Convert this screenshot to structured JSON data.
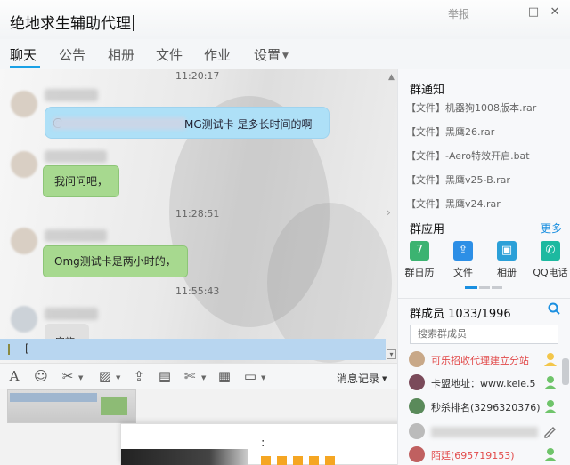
{
  "window": {
    "title": "绝地求生辅助代理",
    "report": "举报",
    "min_icon": "minimize-icon",
    "max_icon": "maximize-icon",
    "close_icon": "close-icon"
  },
  "tabs": [
    {
      "label": "聊天",
      "active": true
    },
    {
      "label": "公告"
    },
    {
      "label": "相册"
    },
    {
      "label": "文件"
    },
    {
      "label": "作业",
      "badge_dot": true
    },
    {
      "label": "设置"
    }
  ],
  "chat": {
    "messages": [
      {
        "time": "11:20:17"
      },
      {
        "text": "@",
        "tail": "MG测试卡 是多长时间的啊",
        "style": "blue"
      },
      {
        "text": "我问问吧，",
        "style": "green"
      },
      {
        "time": "11:28:51"
      },
      {
        "text": "Omg测试卡是两小时的，",
        "style": "green"
      },
      {
        "time": "11:55:43"
      },
      {
        "text": "实施",
        "style": "gray"
      }
    ],
    "input_text": "[",
    "history_label": "消息记录"
  },
  "toolbar": {
    "icons": [
      "font-icon",
      "emoji-icon",
      "scissors-icon",
      "image-icon",
      "upload-icon",
      "gift-icon",
      "cut-icon",
      "text-doc-icon",
      "chat-bubble-icon"
    ]
  },
  "panel": {
    "notice_title": "群通知",
    "files": [
      "【文件】机器狗1008版本.rar",
      "【文件】黑鹰26.rar",
      "【文件】-Aero特效开启.bat",
      "【文件】黑鹰v25-B.rar",
      "【文件】黑鹰v24.rar"
    ],
    "apps_title": "群应用",
    "more": "更多",
    "apps": [
      {
        "label": "群日历",
        "color": "#3cb371",
        "glyph": "7",
        "icon": "calendar-icon"
      },
      {
        "label": "文件",
        "color": "#2d8fe6",
        "glyph": "⇪",
        "icon": "folder-icon"
      },
      {
        "label": "相册",
        "color": "#2ba0d8",
        "glyph": "▣",
        "icon": "photo-icon"
      },
      {
        "label": "QQ电话",
        "color": "#1db9a0",
        "glyph": "✆",
        "icon": "phone-icon"
      }
    ],
    "members_title": "群成员",
    "member_count": "1033/1996",
    "search_placeholder": "搜索群成员",
    "members": [
      {
        "name": "可乐招收代理建立分站",
        "color": "#e24b4b",
        "avatar_color": "#c8a888"
      },
      {
        "name": "卡盟地址：www.kele.5",
        "color": "#333333",
        "avatar_color": "#7a4a5a"
      },
      {
        "name": "秒杀排名(3296320376)",
        "color": "#333333",
        "avatar_color": "#5a8a5a"
      },
      {
        "name": "",
        "color": "#333333",
        "avatar_color": "#bbbbbb"
      },
      {
        "name": "陌廷(695719153)",
        "color": "#e24b4b",
        "avatar_color": "#c06060"
      }
    ]
  }
}
